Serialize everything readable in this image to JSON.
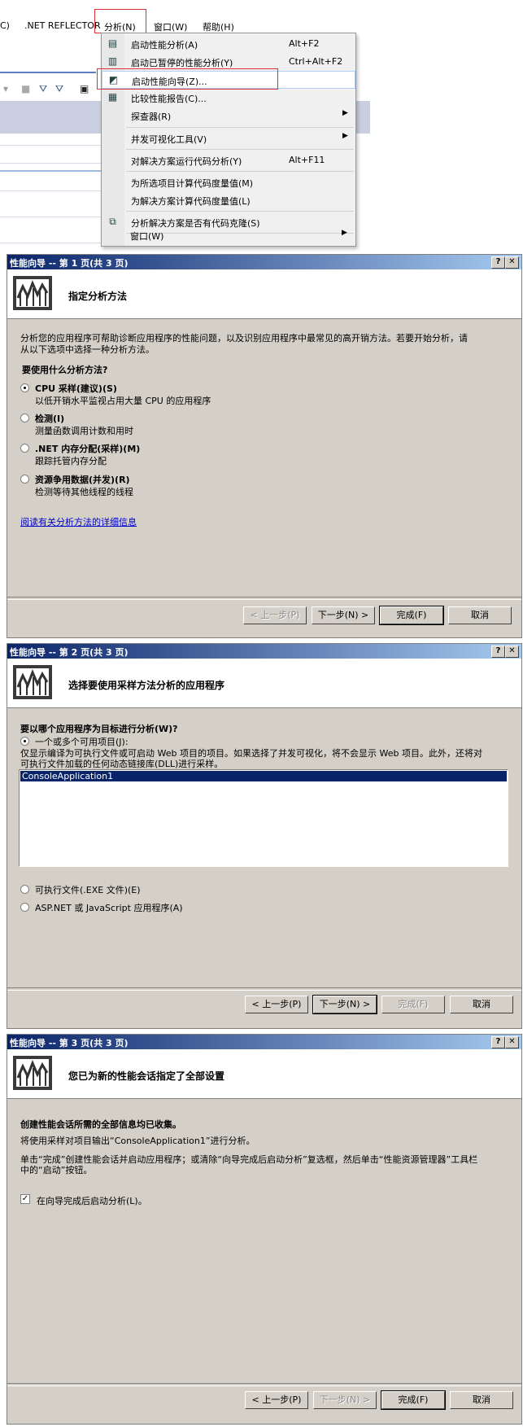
{
  "vs": {
    "menubar": {
      "partial_item": "C)",
      "reflector": ".NET REFLECTOR",
      "analyze": "分析(N)",
      "window": "窗口(W)",
      "help": "帮助(H)"
    },
    "menu": {
      "items": [
        {
          "label": "启动性能分析(A)",
          "shortcut": "Alt+F2"
        },
        {
          "label": "启动已暂停的性能分析(Y)",
          "shortcut": "Ctrl+Alt+F2"
        },
        {
          "label": "启动性能向导(Z)...",
          "shortcut": ""
        },
        {
          "label": "比较性能报告(C)...",
          "shortcut": ""
        },
        {
          "label": "探查器(R)",
          "shortcut": ""
        },
        {
          "label": "并发可视化工具(V)",
          "shortcut": ""
        },
        {
          "label": "对解决方案运行代码分析(Y)",
          "shortcut": "Alt+F11"
        },
        {
          "label": "为所选项目计算代码度量值(M)",
          "shortcut": ""
        },
        {
          "label": "为解决方案计算代码度量值(L)",
          "shortcut": ""
        },
        {
          "label": "分析解决方案是否有代码克隆(S)",
          "shortcut": ""
        },
        {
          "label": "窗口(W)",
          "shortcut": ""
        }
      ]
    }
  },
  "colors": {
    "title_start": "#0a246a",
    "title_end": "#a6caf0",
    "dialog_bg": "#d4d0c8",
    "highlight_box": "#e0303a"
  },
  "dialog1": {
    "title": "性能向导 -- 第 1 页(共 3 页)",
    "header": "指定分析方法",
    "intro1": "分析您的应用程序可帮助诊断应用程序的性能问题，以及识别应用程序中最常见的高开销方法。若要开始分析，请",
    "intro2": "从以下选项中选择一种分析方法。",
    "question": "要使用什么分析方法?",
    "options": [
      {
        "label": "CPU 采样(建议)(S)",
        "desc": "以低开销水平监视占用大量 CPU 的应用程序"
      },
      {
        "label": "检测(I)",
        "desc": "测量函数调用计数和用时"
      },
      {
        "label": ".NET 内存分配(采样)(M)",
        "desc": "跟踪托管内存分配"
      },
      {
        "label": "资源争用数据(并发)(R)",
        "desc": "检测等待其他线程的线程"
      }
    ],
    "link": "阅读有关分析方法的详细信息",
    "buttons": {
      "prev": "< 上一步(P)",
      "next": "下一步(N) >",
      "finish": "完成(F)",
      "cancel": "取消"
    }
  },
  "dialog2": {
    "title": "性能向导 -- 第 2 页(共 3 页)",
    "header": "选择要使用采样方法分析的应用程序",
    "question": "要以哪个应用程序为目标进行分析(W)?",
    "option_projects": "一个或多个可用项目(J):",
    "note1": "仅显示编译为可执行文件或可启动 Web 项目的项目。如果选择了并发可视化，将不会显示 Web 项目。此外，还将对",
    "note2": "可执行文件加载的任何动态链接库(DLL)进行采样。",
    "list_items": [
      "ConsoleApplication1"
    ],
    "option_exe": "可执行文件(.EXE 文件)(E)",
    "option_asp": "ASP.NET 或 JavaScript 应用程序(A)",
    "buttons": {
      "prev": "< 上一步(P)",
      "next": "下一步(N) >",
      "finish": "完成(F)",
      "cancel": "取消"
    }
  },
  "dialog3": {
    "title": "性能向导 -- 第 3 页(共 3 页)",
    "header": "您已为新的性能会话指定了全部设置",
    "summary": "创建性能会话所需的全部信息均已收集。",
    "line1": "将使用采样对项目输出“ConsoleApplication1”进行分析。",
    "line2": "单击“完成”创建性能会话并启动应用程序；或清除“向导完成后启动分析”复选框，然后单击“性能资源管理器”工具栏",
    "line3": "中的“启动”按钮。",
    "checkbox": "在向导完成后启动分析(L)。",
    "buttons": {
      "prev": "< 上一步(P)",
      "next": "下一步(N) >",
      "finish": "完成(F)",
      "cancel": "取消"
    }
  }
}
